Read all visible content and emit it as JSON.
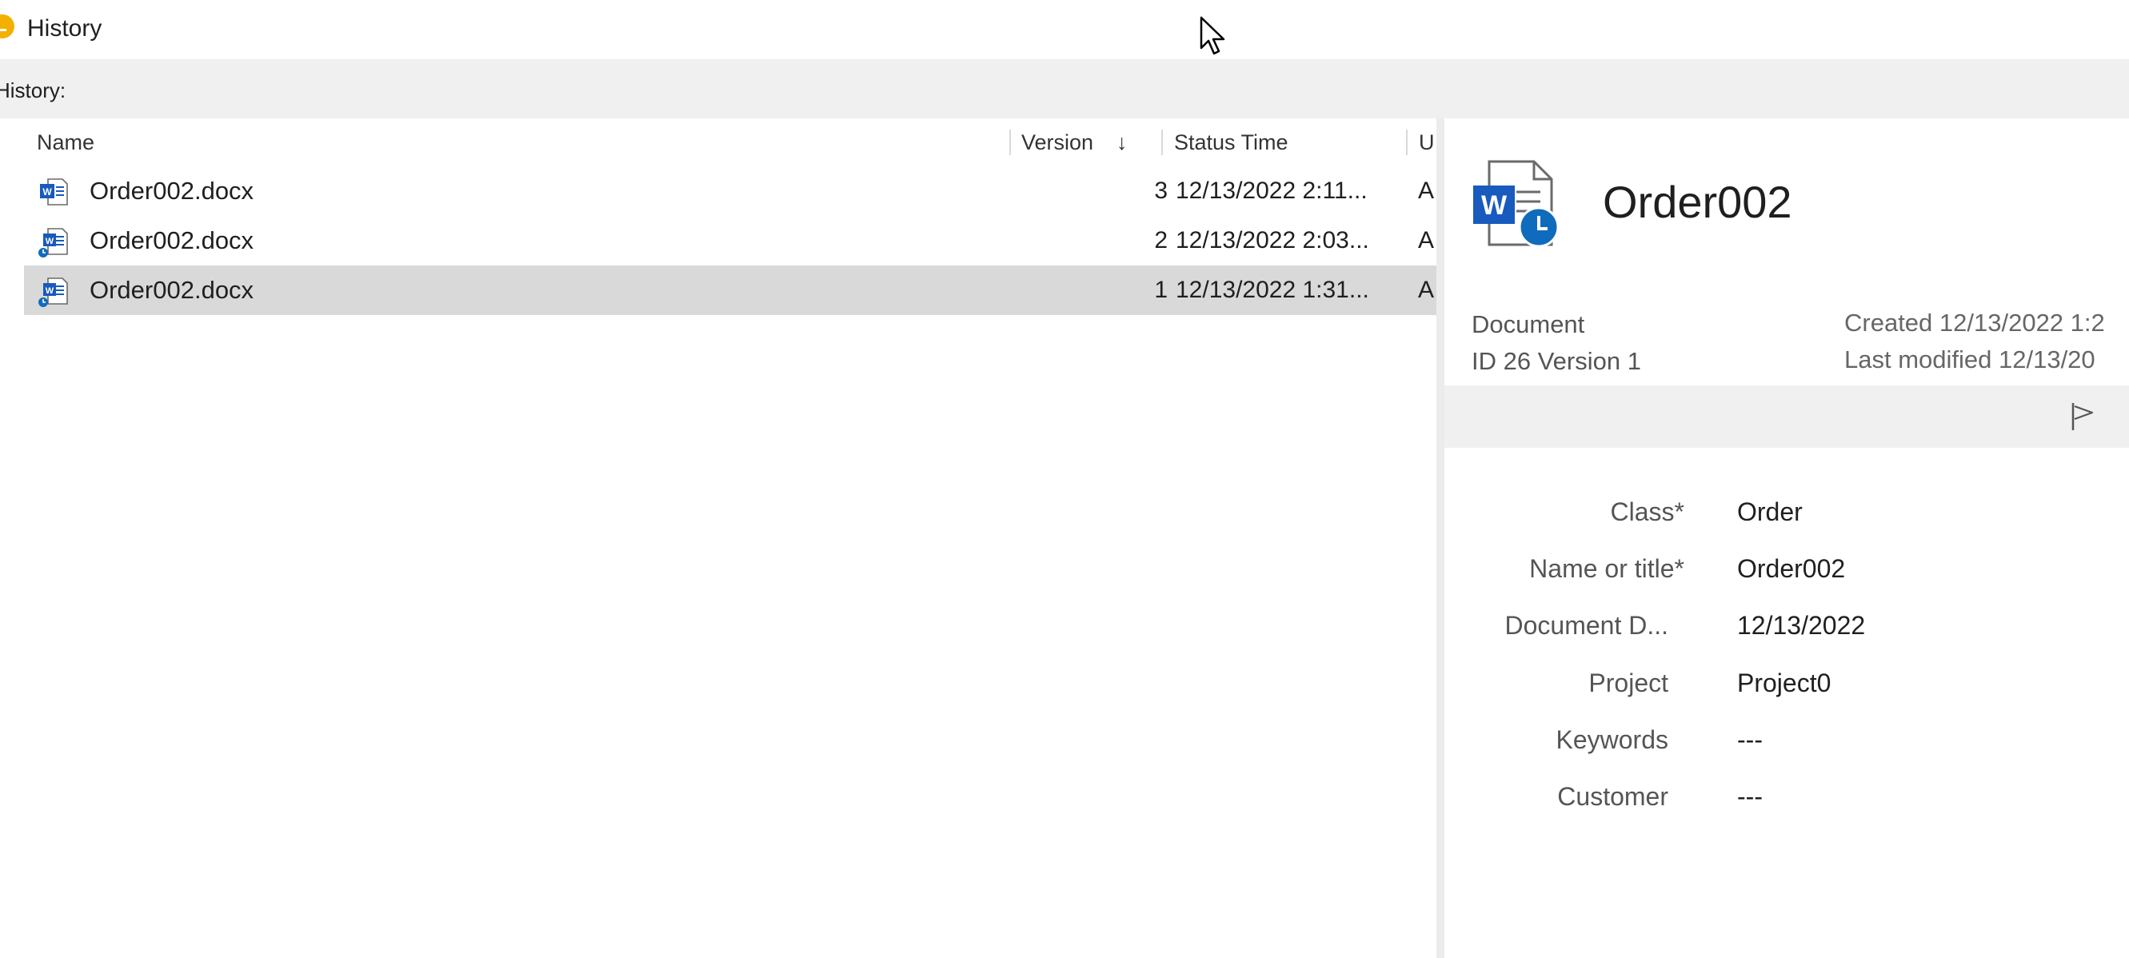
{
  "window": {
    "title": "History",
    "icon": "history-clock-icon"
  },
  "history_bar": {
    "label": "History:"
  },
  "list": {
    "columns": {
      "name": "Name",
      "version": "Version",
      "status_time": "Status Time",
      "user": "U"
    },
    "sort_icon": "sort-down-arrow-icon",
    "rows": [
      {
        "name": "Order002.docx",
        "version": "3",
        "status_time": "12/13/2022 2:11...",
        "user": "A",
        "icon": "word-document-icon",
        "selected": false
      },
      {
        "name": "Order002.docx",
        "version": "2",
        "status_time": "12/13/2022 2:03...",
        "user": "A",
        "icon": "word-document-history-icon",
        "selected": false
      },
      {
        "name": "Order002.docx",
        "version": "1",
        "status_time": "12/13/2022 1:31...",
        "user": "A",
        "icon": "word-document-history-icon",
        "selected": true
      }
    ]
  },
  "details": {
    "title": "Order002",
    "type": "Document",
    "id_version": "ID 26  Version 1",
    "created": "Created 12/13/2022 1:2",
    "last_modified": "Last modified 12/13/20",
    "properties": [
      {
        "label": "Class",
        "value": "Order"
      },
      {
        "label": "Name or title",
        "value": "Order002"
      },
      {
        "label": "Document D...",
        "value": "12/13/2022"
      },
      {
        "label": "Project",
        "value": "Project0"
      },
      {
        "label": "Keywords",
        "value": "---"
      },
      {
        "label": "Customer",
        "value": "---"
      }
    ],
    "required_mark": "*"
  },
  "colors": {
    "word_blue": "#185abd",
    "selected_row": "#d9d9d9",
    "bar_gray": "#f0f0f0",
    "accent_yellow": "#f2b100"
  }
}
